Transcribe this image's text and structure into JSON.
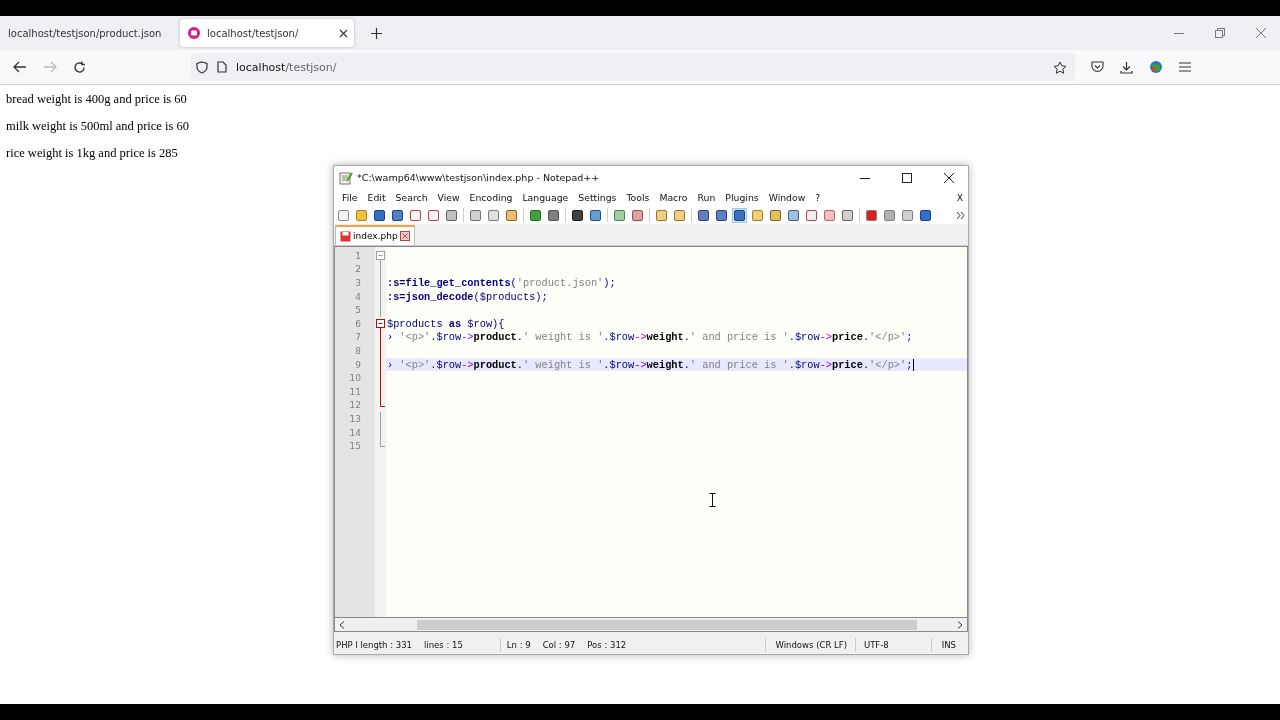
{
  "browser": {
    "tabs": [
      {
        "title": "localhost/testjson/product.json",
        "selected": false
      },
      {
        "title": "localhost/testjson/",
        "selected": true
      }
    ],
    "address": {
      "host": "localhost",
      "path": "/testjson/"
    }
  },
  "page": {
    "paragraphs": [
      "bread weight is 400g and price is 60",
      "milk weight is 500ml and price is 60",
      "rice weight is 1kg and price is 285"
    ]
  },
  "editor": {
    "title": "*C:\\wamp64\\www\\testjson\\index.php - Notepad++",
    "menu": [
      "File",
      "Edit",
      "Search",
      "View",
      "Encoding",
      "Language",
      "Settings",
      "Tools",
      "Macro",
      "Run",
      "Plugins",
      "Window",
      "?"
    ],
    "close_document": "X",
    "file_tab": {
      "label": "index.php",
      "modified": true
    },
    "lines": [
      {
        "number": "1",
        "fold_point": true,
        "active_block": false,
        "current": false
      },
      {
        "number": "2",
        "fold_point": false,
        "active_block": false,
        "current": false
      },
      {
        "number": "3",
        "fold_point": false,
        "active_block": false,
        "current": false,
        "tokens": [
          {
            "kind": "fn",
            "text": ":s=file_get_contents"
          },
          {
            "kind": "op",
            "text": "("
          },
          {
            "kind": "str",
            "text": "'product.json'"
          },
          {
            "kind": "op",
            "text": ");"
          }
        ]
      },
      {
        "number": "4",
        "fold_point": false,
        "active_block": false,
        "current": false,
        "tokens": [
          {
            "kind": "fn",
            "text": ":s=json_decode"
          },
          {
            "kind": "op",
            "text": "("
          },
          {
            "kind": "var",
            "text": "$products"
          },
          {
            "kind": "op",
            "text": ");"
          }
        ]
      },
      {
        "number": "5",
        "fold_point": false,
        "active_block": false,
        "current": false
      },
      {
        "number": "6",
        "fold_point": true,
        "active_block": true,
        "current": false,
        "tokens": [
          {
            "kind": "var",
            "text": "$products"
          },
          {
            "kind": "kw",
            "text": " as "
          },
          {
            "kind": "var",
            "text": "$row"
          },
          {
            "kind": "op",
            "text": "){"
          }
        ]
      },
      {
        "number": "7",
        "fold_point": false,
        "active_block": true,
        "current": false,
        "tokens": [
          {
            "kind": "op",
            "text": "› "
          },
          {
            "kind": "str",
            "text": "'<p>'"
          },
          {
            "kind": "op",
            "text": "."
          },
          {
            "kind": "var",
            "text": "$row"
          },
          {
            "kind": "arrow",
            "text": "->"
          },
          {
            "kind": "plain",
            "text": "product"
          },
          {
            "kind": "op",
            "text": "."
          },
          {
            "kind": "str",
            "text": "' weight is '"
          },
          {
            "kind": "op",
            "text": "."
          },
          {
            "kind": "var",
            "text": "$row"
          },
          {
            "kind": "arrow",
            "text": "->"
          },
          {
            "kind": "plain",
            "text": "weight"
          },
          {
            "kind": "op",
            "text": "."
          },
          {
            "kind": "str",
            "text": "' and price is '"
          },
          {
            "kind": "op",
            "text": "."
          },
          {
            "kind": "var",
            "text": "$row"
          },
          {
            "kind": "arrow",
            "text": "->"
          },
          {
            "kind": "plain",
            "text": "price"
          },
          {
            "kind": "op",
            "text": "."
          },
          {
            "kind": "str",
            "text": "'</p>'"
          },
          {
            "kind": "op",
            "text": ";"
          }
        ]
      },
      {
        "number": "8",
        "fold_point": false,
        "active_block": true,
        "current": false
      },
      {
        "number": "9",
        "fold_point": false,
        "active_block": true,
        "current": true,
        "tokens": [
          {
            "kind": "op",
            "text": "› "
          },
          {
            "kind": "str",
            "text": "'<p>'"
          },
          {
            "kind": "op",
            "text": "."
          },
          {
            "kind": "var",
            "text": "$row"
          },
          {
            "kind": "arrow",
            "text": "->"
          },
          {
            "kind": "plain",
            "text": "product"
          },
          {
            "kind": "op",
            "text": "."
          },
          {
            "kind": "str",
            "text": "' weight is '"
          },
          {
            "kind": "op",
            "text": "."
          },
          {
            "kind": "var",
            "text": "$row"
          },
          {
            "kind": "arrow",
            "text": "->"
          },
          {
            "kind": "plain",
            "text": "weight"
          },
          {
            "kind": "op",
            "text": "."
          },
          {
            "kind": "str",
            "text": "' and price is '"
          },
          {
            "kind": "op",
            "text": "."
          },
          {
            "kind": "var",
            "text": "$row"
          },
          {
            "kind": "arrow",
            "text": "->"
          },
          {
            "kind": "plain",
            "text": "price"
          },
          {
            "kind": "op",
            "text": "."
          },
          {
            "kind": "str",
            "text": "'</p>'"
          },
          {
            "kind": "op",
            "text": ";"
          }
        ]
      },
      {
        "number": "10",
        "fold_point": false,
        "active_block": true,
        "current": false
      },
      {
        "number": "11",
        "fold_point": false,
        "active_block": true,
        "current": false
      },
      {
        "number": "12",
        "fold_point": false,
        "active_block": true,
        "current": false
      },
      {
        "number": "13",
        "fold_point": false,
        "active_block": false,
        "current": false
      },
      {
        "number": "14",
        "fold_point": false,
        "active_block": false,
        "current": false
      },
      {
        "number": "15",
        "fold_point": false,
        "active_block": false,
        "current": false
      }
    ],
    "status": {
      "file_info": "PHP l length : 331",
      "line_count": "lines : 15",
      "position": [
        "Ln : 9",
        "Col : 97",
        "Pos : 312"
      ],
      "eol": "Windows (CR LF)",
      "encoding": "UTF-8",
      "mode": "INS"
    }
  }
}
